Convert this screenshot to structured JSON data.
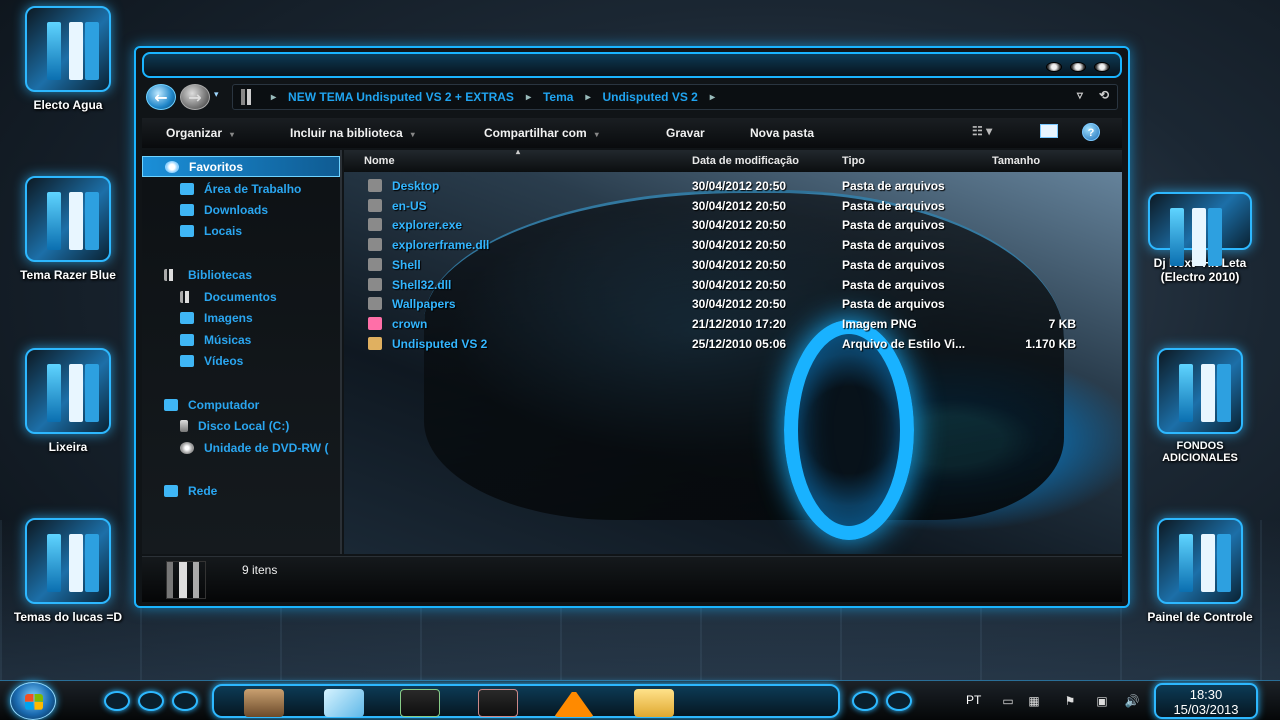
{
  "desktop": {
    "icons_left": [
      {
        "label": "Electo Agua"
      },
      {
        "label": "Tema Razer Blue"
      },
      {
        "label": "Lixeira"
      },
      {
        "label": "Temas do lucas =D"
      }
    ],
    "icons_right": [
      {
        "label": "Dj Next- Hit Leta (Electro 2010)"
      },
      {
        "label": "FONDOS ADICIONALES"
      },
      {
        "label": "Painel de Controle"
      }
    ]
  },
  "window": {
    "breadcrumbs": [
      "NEW TEMA Undisputed VS 2 + EXTRAS",
      "Tema",
      "Undisputed VS 2"
    ],
    "toolbar": {
      "organize": "Organizar",
      "include_library": "Incluir na biblioteca",
      "share": "Compartilhar com",
      "burn": "Gravar",
      "new_folder": "Nova pasta"
    },
    "sidebar": {
      "favorites": {
        "label": "Favoritos",
        "items": [
          "Área de Trabalho",
          "Downloads",
          "Locais"
        ]
      },
      "libraries": {
        "label": "Bibliotecas",
        "items": [
          "Documentos",
          "Imagens",
          "Músicas",
          "Vídeos"
        ]
      },
      "computer": {
        "label": "Computador",
        "items": [
          "Disco Local (C:)",
          "Unidade de DVD-RW ("
        ]
      },
      "network": {
        "label": "Rede"
      }
    },
    "columns": {
      "name": "Nome",
      "date": "Data de modificação",
      "type": "Tipo",
      "size": "Tamanho"
    },
    "files": [
      {
        "name": "Desktop",
        "date": "30/04/2012 20:50",
        "type": "Pasta de arquivos",
        "size": "",
        "icon": "folder"
      },
      {
        "name": "en-US",
        "date": "30/04/2012 20:50",
        "type": "Pasta de arquivos",
        "size": "",
        "icon": "folder"
      },
      {
        "name": "explorer.exe",
        "date": "30/04/2012 20:50",
        "type": "Pasta de arquivos",
        "size": "",
        "icon": "folder"
      },
      {
        "name": "explorerframe.dll",
        "date": "30/04/2012 20:50",
        "type": "Pasta de arquivos",
        "size": "",
        "icon": "folder"
      },
      {
        "name": "Shell",
        "date": "30/04/2012 20:50",
        "type": "Pasta de arquivos",
        "size": "",
        "icon": "folder"
      },
      {
        "name": "Shell32.dll",
        "date": "30/04/2012 20:50",
        "type": "Pasta de arquivos",
        "size": "",
        "icon": "folder"
      },
      {
        "name": "Wallpapers",
        "date": "30/04/2012 20:50",
        "type": "Pasta de arquivos",
        "size": "",
        "icon": "folder"
      },
      {
        "name": "crown",
        "date": "21/12/2010 17:20",
        "type": "Imagem PNG",
        "size": "7 KB",
        "icon": "png"
      },
      {
        "name": "Undisputed VS 2",
        "date": "25/12/2010 05:06",
        "type": "Arquivo de Estilo Vi...",
        "size": "1.170 KB",
        "icon": "theme"
      }
    ],
    "status": {
      "count": "9 itens"
    }
  },
  "taskbar": {
    "language": "PT",
    "time": "18:30",
    "date": "15/03/2013"
  },
  "colors": {
    "accent": "#1ab4ff",
    "link": "#33b6ff"
  }
}
